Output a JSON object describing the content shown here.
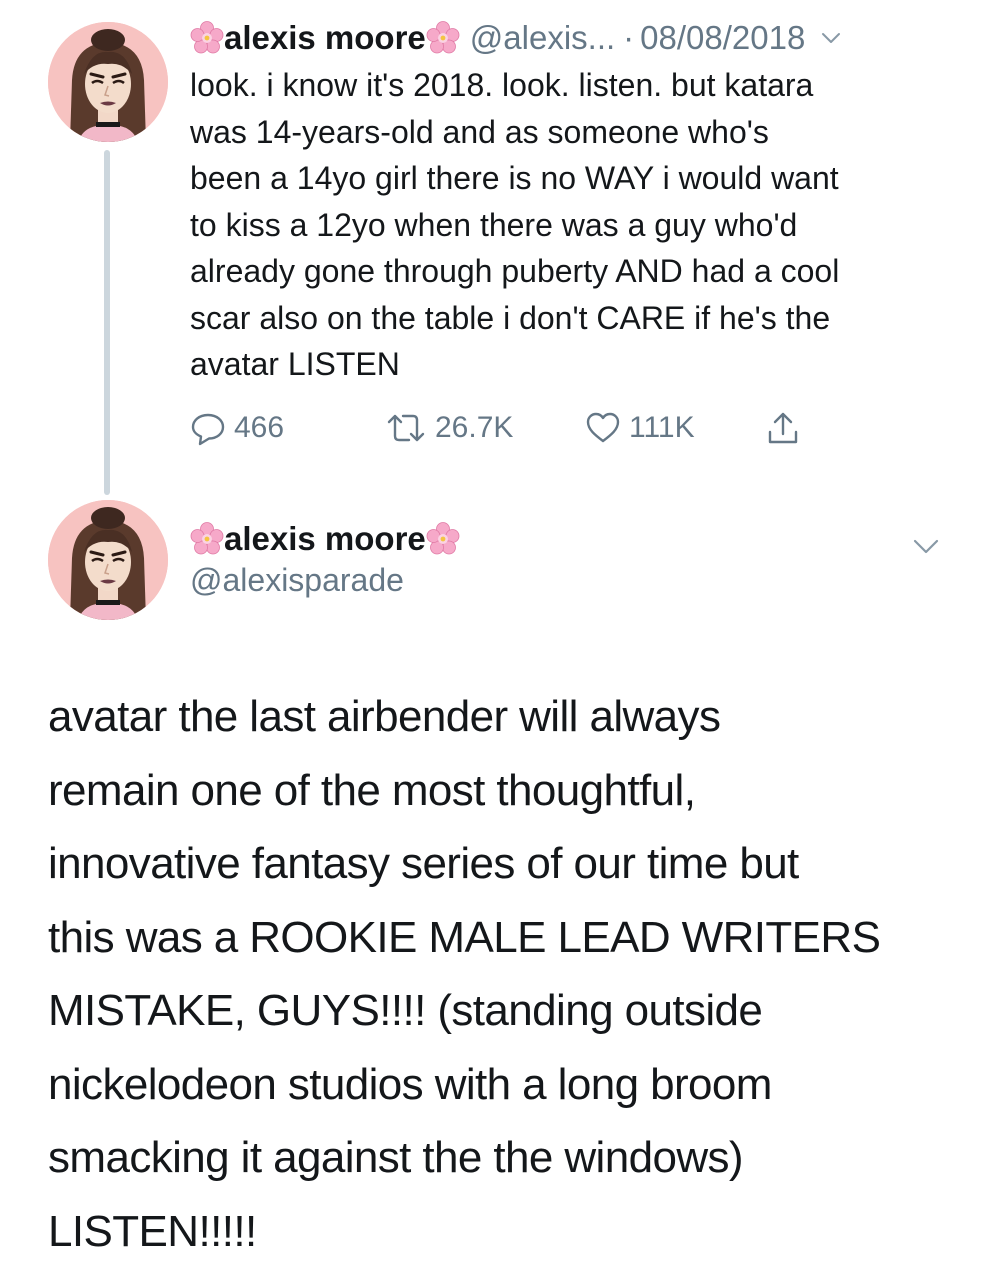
{
  "tweet1": {
    "display_name": "alexis moore",
    "handle_truncated": "@alexis...",
    "separator": "·",
    "date": "08/08/2018",
    "text": "look. i know it's 2018. look. listen. but katara\nwas 14-years-old and as someone who's\nbeen a 14yo girl there is no WAY i would want\nto kiss a 12yo when there was a guy who'd\nalready gone through puberty AND had a cool\nscar also on the table i don't CARE if he's the\navatar LISTEN",
    "replies": "466",
    "retweets": "26.7K",
    "likes": "111K"
  },
  "tweet2": {
    "display_name": "alexis moore",
    "handle": "@alexisparade",
    "text": "avatar the last airbender will always\nremain one of the most thoughtful,\ninnovative fantasy series of our time but\nthis was a ROOKIE MALE LEAD WRITERS\nMISTAKE, GUYS!!!! (standing outside\nnickelodeon studios with a long broom\nsmacking it against the the windows)\nLISTEN!!!!!"
  },
  "icons": {
    "name_decoration": "cherry-blossom-icon",
    "reply": "reply-icon",
    "retweet": "retweet-icon",
    "like": "heart-icon",
    "share": "share-icon",
    "menu": "chevron-down-icon"
  },
  "colors": {
    "text": "#14171a",
    "secondary": "#657786",
    "thread_line": "#ccd6dd",
    "avatar_bg": "#f7c3c1",
    "blossom": "#f6a9c9"
  }
}
